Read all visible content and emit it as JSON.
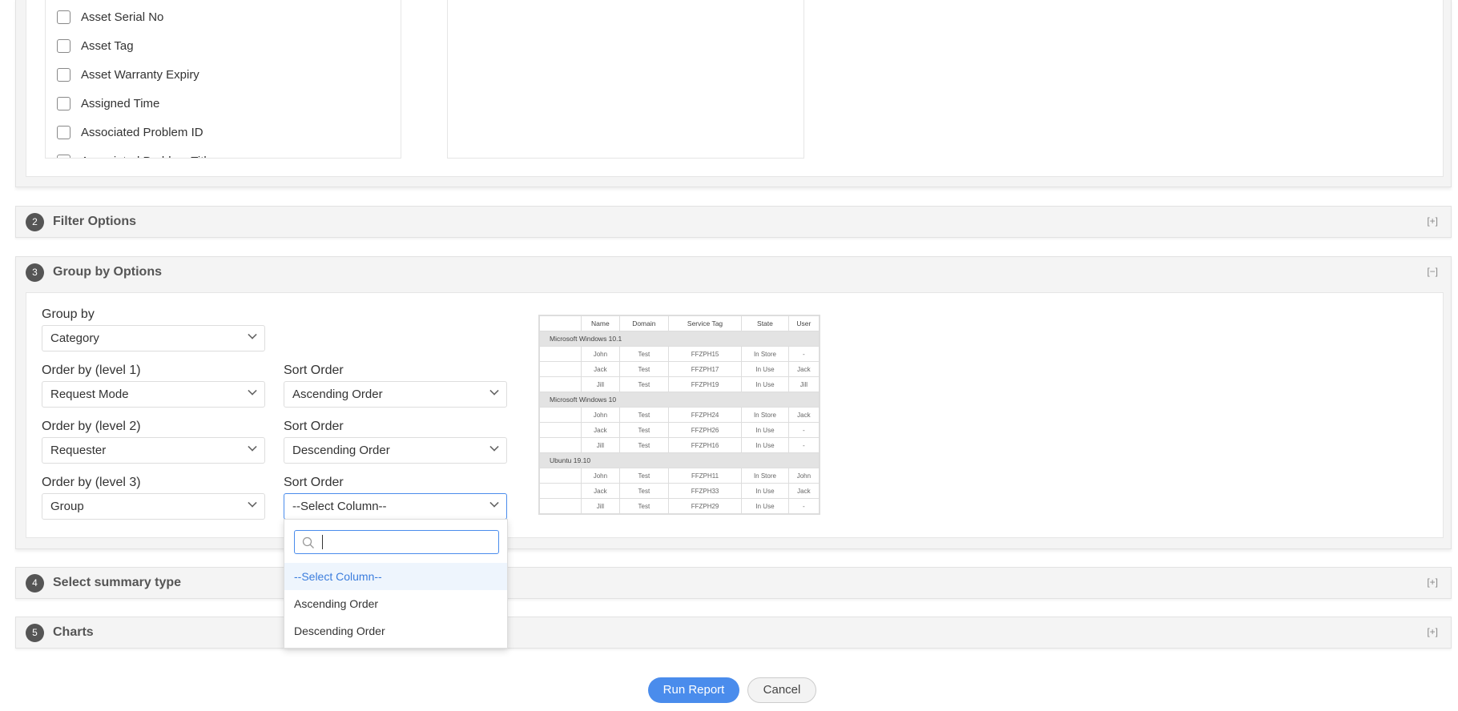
{
  "columns_section": {
    "available_columns": [
      "Asset Serial No",
      "Asset Tag",
      "Asset Warranty Expiry",
      "Assigned Time",
      "Associated Problem ID",
      "Associated Problem Title"
    ]
  },
  "sections": [
    {
      "number": "2",
      "title": "Filter Options",
      "toggle": "[+]"
    },
    {
      "number": "3",
      "title": "Group by Options",
      "toggle": "[−]"
    },
    {
      "number": "4",
      "title": "Select summary type",
      "toggle": "[+]"
    },
    {
      "number": "5",
      "title": "Charts",
      "toggle": "[+]"
    }
  ],
  "group_by": {
    "group_by_label": "Group by",
    "group_by_value": "Category",
    "levels": [
      {
        "label": "Order by (level 1)",
        "value": "Request Mode",
        "sort_label": "Sort Order",
        "sort_value": "Ascending Order"
      },
      {
        "label": "Order by (level 2)",
        "value": "Requester",
        "sort_label": "Sort Order",
        "sort_value": "Descending Order"
      },
      {
        "label": "Order by (level 3)",
        "value": "Group",
        "sort_label": "Sort Order",
        "sort_value": "--Select Column--"
      }
    ],
    "dropdown": {
      "search_value": "",
      "options": [
        "--Select Column--",
        "Ascending Order",
        "Descending Order"
      ],
      "highlighted": "--Select Column--"
    }
  },
  "preview": {
    "headers": [
      "",
      "Name",
      "Domain",
      "Service Tag",
      "State",
      "User"
    ],
    "groups": [
      {
        "name": "Microsoft Windows 10.1",
        "rows": [
          [
            "John",
            "Test",
            "FFZPH15",
            "In Store",
            "-"
          ],
          [
            "Jack",
            "Test",
            "FFZPH17",
            "In Use",
            "Jack"
          ],
          [
            "Jill",
            "Test",
            "FFZPH19",
            "In Use",
            "Jill"
          ]
        ]
      },
      {
        "name": "Microsoft Windows 10",
        "rows": [
          [
            "John",
            "Test",
            "FFZPH24",
            "In Store",
            "Jack"
          ],
          [
            "Jack",
            "Test",
            "FFZPH26",
            "In Use",
            "-"
          ],
          [
            "Jill",
            "Test",
            "FFZPH16",
            "In Use",
            "-"
          ]
        ]
      },
      {
        "name": "Ubuntu 19.10",
        "rows": [
          [
            "John",
            "Test",
            "FFZPH11",
            "In Store",
            "John"
          ],
          [
            "Jack",
            "Test",
            "FFZPH33",
            "In Use",
            "Jack"
          ],
          [
            "Jill",
            "Test",
            "FFZPH29",
            "In Use",
            "-"
          ]
        ]
      }
    ]
  },
  "actions": {
    "run": "Run Report",
    "cancel": "Cancel"
  },
  "colors": {
    "primary": "#4a8cec",
    "highlight_bg": "#eef5fd",
    "highlight_text": "#3b7ddd"
  }
}
